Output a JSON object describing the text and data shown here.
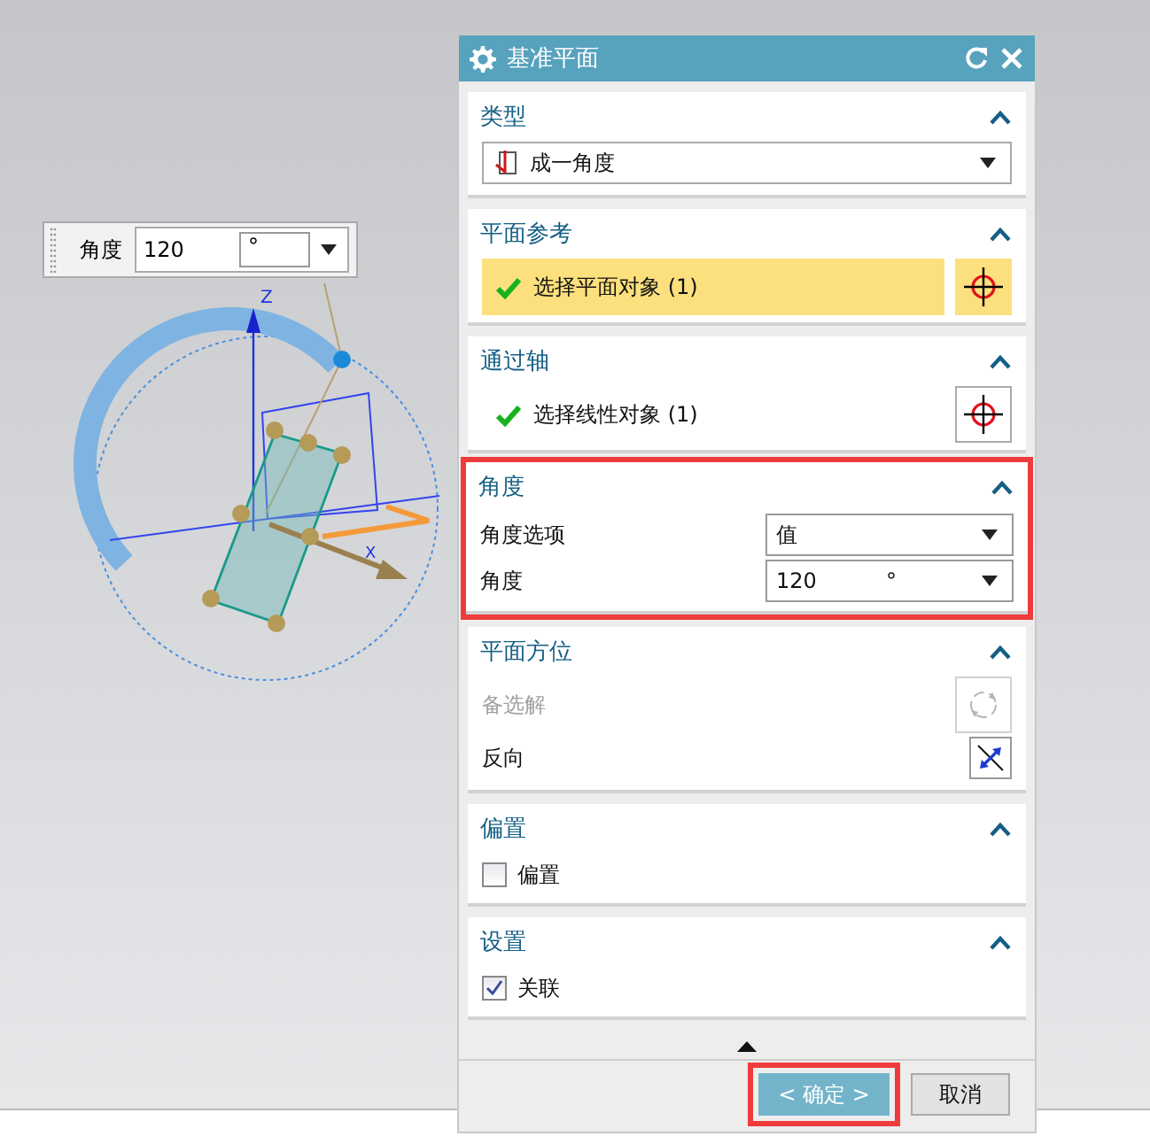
{
  "floating_input": {
    "label": "角度",
    "value": "120",
    "unit": "°"
  },
  "diagram": {
    "axis_labels": [
      "Z",
      "X"
    ]
  },
  "window": {
    "title": "基准平面"
  },
  "sections": [
    {
      "title": "类型",
      "expanded": true,
      "highlighted": false,
      "rows": [
        {
          "kind": "dropdown",
          "value": "成一角度"
        }
      ]
    },
    {
      "title": "平面参考",
      "expanded": true,
      "highlighted": false,
      "rows": [
        {
          "kind": "selection",
          "label": "选择平面对象 (1)",
          "done": true,
          "selected": true
        }
      ]
    },
    {
      "title": "通过轴",
      "expanded": true,
      "highlighted": false,
      "rows": [
        {
          "kind": "selection",
          "label": "选择线性对象 (1)",
          "done": true,
          "selected": false
        }
      ]
    },
    {
      "title": "角度",
      "expanded": true,
      "highlighted": true,
      "rows": [
        {
          "kind": "choice",
          "label": "角度选项",
          "value": "值"
        },
        {
          "kind": "measure",
          "label": "角度",
          "value": "120",
          "unit": "°"
        }
      ]
    },
    {
      "title": "平面方位",
      "expanded": true,
      "highlighted": false,
      "rows": [
        {
          "kind": "alternate",
          "label": "备选解",
          "disabled": true
        },
        {
          "kind": "reverse",
          "label": "反向",
          "disabled": false
        }
      ]
    },
    {
      "title": "偏置",
      "expanded": true,
      "highlighted": false,
      "rows": [
        {
          "kind": "checkbox",
          "label": "偏置",
          "checked": false
        }
      ]
    },
    {
      "title": "设置",
      "expanded": true,
      "highlighted": false,
      "rows": [
        {
          "kind": "checkbox",
          "label": "关联",
          "checked": true
        }
      ]
    }
  ],
  "buttons": [
    {
      "label": "< 确定 >",
      "kind": "primary",
      "highlighted": true
    },
    {
      "label": "取消",
      "kind": "secondary",
      "highlighted": false
    }
  ]
}
